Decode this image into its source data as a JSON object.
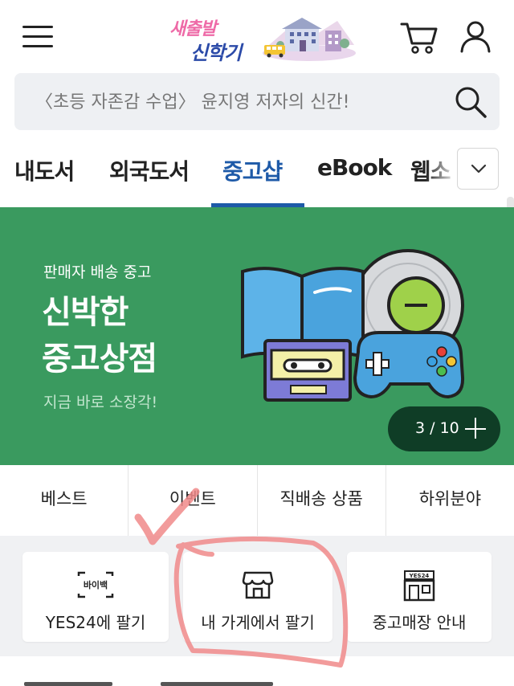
{
  "header": {
    "logo_line1": "새출발",
    "logo_line2": "신학기",
    "menu_icon": "hamburger-icon",
    "cart_icon": "cart-icon",
    "user_icon": "user-icon"
  },
  "search": {
    "placeholder": "〈초등 자존감 수업〉 윤지영 저자의 신간!",
    "icon": "search-icon"
  },
  "tabs": {
    "items": [
      {
        "label": "내도서"
      },
      {
        "label": "외국도서"
      },
      {
        "label": "중고샵",
        "active": true
      },
      {
        "label": "eBook"
      },
      {
        "label": "웹소"
      }
    ],
    "more_icon": "chevron-down-icon",
    "active_color": "#1e5aa8"
  },
  "banner": {
    "subtitle": "판매자 배송 중고",
    "title_line1": "신박한",
    "title_line2": "중고상점",
    "cta": "지금 바로 소장각!",
    "pager_count": "3 / 10",
    "background": "#3a9a5f"
  },
  "subnav": {
    "items": [
      "베스트",
      "이벤트",
      "직배송 상품",
      "하위분야"
    ]
  },
  "shortcuts": {
    "items": [
      {
        "label": "YES24에 팔기",
        "icon": "buyback-icon",
        "icon_text": "바이백"
      },
      {
        "label": "내 가게에서 팔기",
        "icon": "store-icon"
      },
      {
        "label": "중고매장 안내",
        "icon": "shop-building-icon",
        "icon_text": "YES24"
      }
    ]
  }
}
